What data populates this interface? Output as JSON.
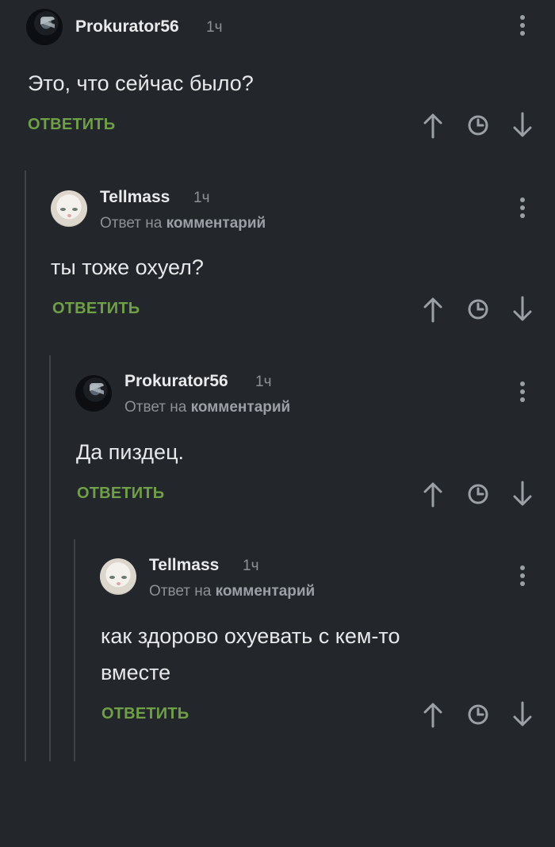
{
  "theme": {
    "background": "#23272b",
    "accent": "#6fa047",
    "muted": "#8c9196",
    "thread_line": "#3f444a"
  },
  "comments": [
    {
      "author": "Prokurator56",
      "time": "1ч",
      "text": "Это, что сейчас было?",
      "avatar": "dark-avatar",
      "reply_label": "ОТВЕТИТЬ"
    },
    {
      "author": "Tellmass",
      "time": "1ч",
      "reply_prefix": "Ответ на",
      "reply_target": "комментарий",
      "text": "ты тоже охуел?",
      "avatar": "cat-avatar",
      "reply_label": "ОТВЕТИТЬ"
    },
    {
      "author": "Prokurator56",
      "time": "1ч",
      "reply_prefix": "Ответ на",
      "reply_target": "комментарий",
      "text": "Да пиздец.",
      "avatar": "dark-avatar",
      "reply_label": "ОТВЕТИТЬ"
    },
    {
      "author": "Tellmass",
      "time": "1ч",
      "reply_prefix": "Ответ на",
      "reply_target": "комментарий",
      "text_lines": [
        "как здорово охуевать с кем-то",
        "вместе"
      ],
      "avatar": "cat-avatar",
      "reply_label": "ОТВЕТИТЬ"
    }
  ],
  "icons": [
    "more-vertical-icon",
    "arrow-up-icon",
    "clock-icon",
    "arrow-down-icon"
  ]
}
